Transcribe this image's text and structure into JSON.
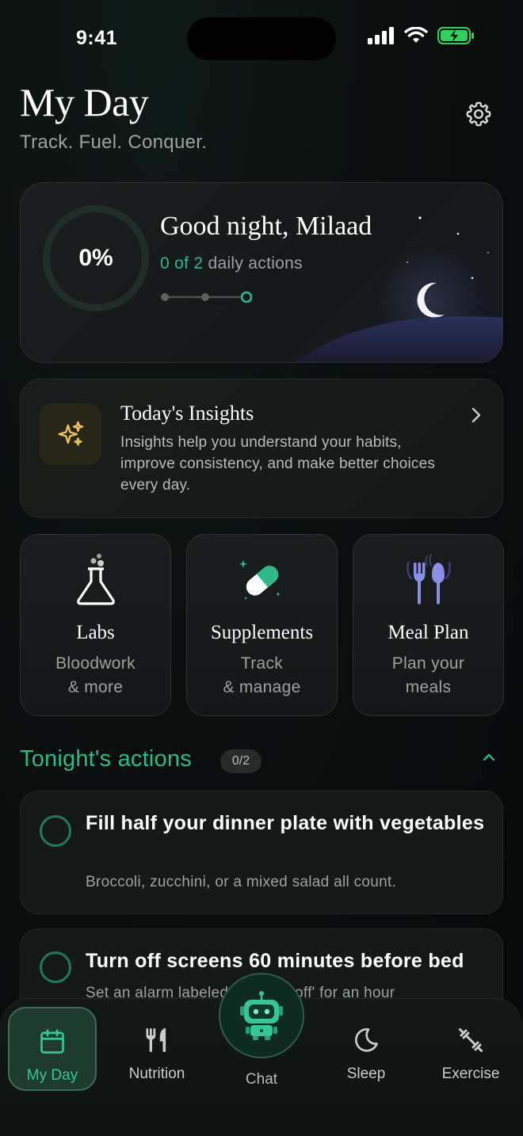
{
  "status_bar": {
    "time": "9:41"
  },
  "header": {
    "title": "My Day",
    "subtitle": "Track. Fuel. Conquer."
  },
  "greeting": {
    "progress_label": "0%",
    "progress": 0,
    "title": "Good night, Milaad",
    "actions_done_text": "0 of 2",
    "actions_suffix": "daily actions"
  },
  "insights": {
    "title": "Today's Insights",
    "body": "Insights help you understand your habits, improve consistency, and make better choices every day."
  },
  "tiles": [
    {
      "title": "Labs",
      "line1": "Bloodwork",
      "line2": "& more"
    },
    {
      "title": "Supplements",
      "line1": "Track",
      "line2": "& manage"
    },
    {
      "title": "Meal Plan",
      "line1": "Plan your",
      "line2": "meals"
    }
  ],
  "section": {
    "title": "Tonight's actions",
    "badge": "0/2"
  },
  "actions": [
    {
      "title": "Fill half your dinner plate with vegetables",
      "desc": "Broccoli, zucchini, or a mixed salad all count."
    },
    {
      "title": "Turn off screens 60 minutes before bed",
      "desc": "Set an alarm labeled 'screens off' for an hour"
    }
  ],
  "tabs": [
    {
      "label": "My Day",
      "icon": "calendar-icon",
      "active": true
    },
    {
      "label": "Nutrition",
      "icon": "fork-knife-icon"
    },
    {
      "label": "Chat",
      "icon": "robot-icon"
    },
    {
      "label": "Sleep",
      "icon": "moon-icon"
    },
    {
      "label": "Exercise",
      "icon": "dumbbell-icon"
    }
  ],
  "colors": {
    "accent": "#2fb98a",
    "background": "#0a0f0e",
    "card": "#161a1a",
    "muted_text": "#9aa3a0"
  }
}
